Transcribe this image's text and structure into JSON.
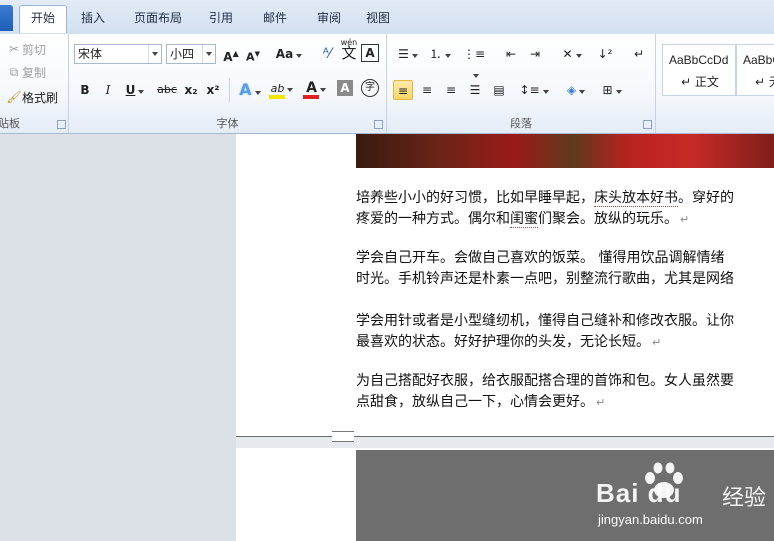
{
  "tabs": [
    {
      "label": "开始",
      "active": true
    },
    {
      "label": "插入"
    },
    {
      "label": "页面布局"
    },
    {
      "label": "引用"
    },
    {
      "label": "邮件"
    },
    {
      "label": "审阅"
    },
    {
      "label": "视图"
    }
  ],
  "clipboard": {
    "cut": "剪切",
    "copy": "复制",
    "format_painter": "格式刷",
    "group_label": "贴板"
  },
  "font": {
    "name": "宋体",
    "size": "小四",
    "grow": "A",
    "shrink": "A",
    "case": "Aa",
    "wen": "wén",
    "char_border": "A",
    "bold": "B",
    "italic": "I",
    "underline": "U",
    "strike": "abc",
    "subscript": "x₂",
    "superscript": "x²",
    "text_effect": "A",
    "highlight": "ab",
    "font_color": "A",
    "shading": "A",
    "enclose": "字",
    "group_label": "字体",
    "highlight_color": "#f5e400",
    "font_color_value": "#e02020"
  },
  "paragraph": {
    "group_label": "段落"
  },
  "styles": [
    {
      "sample": "AaBbCcDd",
      "name": "↵ 正文"
    },
    {
      "sample": "AaBbC",
      "name": "↵ 无间"
    }
  ],
  "document": {
    "paragraphs": [
      [
        "培养些小小的好习惯，比如早睡早起，",
        "床头放本好书",
        "。穿好的",
        "疼爱的一种方式。偶尔和",
        "闺蜜",
        "们聚会。放纵的玩乐。"
      ],
      [
        "学会自己开车。会做自己喜欢的饭菜。  懂得用饮品调解情绪",
        "时光。手机铃声还是朴素一点吧，别整流行歌曲，尤其是网络"
      ],
      [
        "学会用针或者是小型缝纫机，懂得自己缝补和修改衣服。让你",
        "最喜欢的状态。好好护理你的头发，无论长短。"
      ],
      [
        "为自己搭配好衣服，给衣服配搭合理的首饰和包。女人虽然要",
        "点甜食，放纵自己一下，心情会更好。"
      ]
    ],
    "paragraph_mark": "↵"
  },
  "watermark": {
    "brand": "Bai  du",
    "sub": "经验",
    "url": "jingyan.baidu.com"
  }
}
